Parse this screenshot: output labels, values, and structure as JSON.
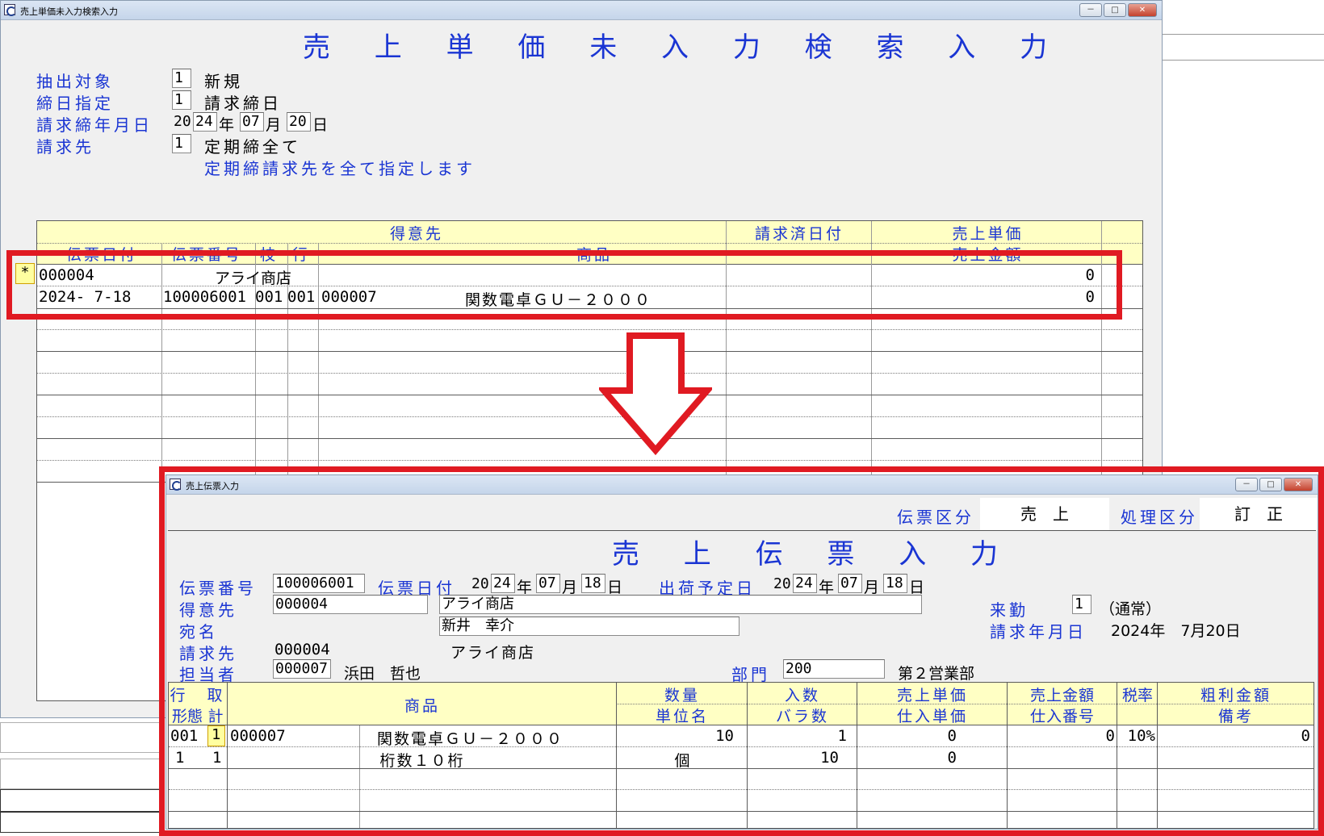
{
  "search_window": {
    "title": "売上単価未入力検索入力",
    "heading": "売 上 単 価 未 入 力 検 索 入 力",
    "titlebar_buttons": {
      "minimize": "－",
      "maximize": "□",
      "close": "✕"
    },
    "form": {
      "extract_label": "抽出対象",
      "extract_value": "1",
      "extract_text": "新規",
      "closing_label": "締日指定",
      "closing_value": "1",
      "closing_text": "請求締日",
      "date_label": "請求締年月日",
      "date_prefix": "20",
      "date_year": "24",
      "date_year_unit": "年",
      "date_month": "07",
      "date_month_unit": "月",
      "date_day": "20",
      "date_day_unit": "日",
      "billing_label": "請求先",
      "billing_value": "1",
      "billing_text": "定期締全て",
      "billing_note": "定期締請求先を全て指定します"
    },
    "grid": {
      "head_row1": {
        "customer": "得意先",
        "billed_date": "請求済日付",
        "unit_price": "売上単価"
      },
      "head_row2": {
        "slip_date": "伝票日付",
        "slip_no": "伝票番号",
        "branch": "枝",
        "line": "行",
        "product": "商品",
        "amount": "売上金額"
      },
      "marker": "*",
      "row1": {
        "customer_code": "000004",
        "customer_name": "アライ商店",
        "unit_price": "0"
      },
      "row2": {
        "slip_date": "2024- 7-18",
        "slip_no": "100006001",
        "branch": "001",
        "line": "001",
        "product_code": "000007",
        "product_name": "関数電卓ＧＵ－２０００",
        "amount": "0"
      }
    }
  },
  "slip_window": {
    "title": "売上伝票入力",
    "heading": "売 上 伝 票 入 力",
    "titlebar_buttons": {
      "minimize": "－",
      "maximize": "□",
      "close": "✕"
    },
    "top": {
      "slip_type_label": "伝票区分",
      "slip_type_value": "売　上",
      "process_label": "処理区分",
      "process_value": "訂　正"
    },
    "form": {
      "slip_no_label": "伝票番号",
      "slip_no": "100006001",
      "slip_date_label": "伝票日付",
      "slip_date_prefix": "20",
      "slip_date_year": "24",
      "slip_date_month": "07",
      "slip_date_day": "18",
      "ship_date_label": "出荷予定日",
      "ship_date_prefix": "20",
      "ship_date_year": "24",
      "ship_date_month": "07",
      "ship_date_day": "18",
      "unit_year": "年",
      "unit_month": "月",
      "unit_day": "日",
      "customer_label": "得意先",
      "customer_code": "000004",
      "customer_name": "アライ商店",
      "visit_label": "来勤",
      "visit_value": "1",
      "visit_text": "（通常）",
      "addressee_label": "宛名",
      "addressee": "新井　幸介",
      "bill_month_label": "請求年月日",
      "bill_month_value": "2024年　7月20日",
      "billing_label": "請求先",
      "billing_code": "000004",
      "billing_name": "アライ商店",
      "staff_label": "担当者",
      "staff_code": "000007",
      "staff_name": "浜田　哲也",
      "dept_label": "部門",
      "dept_code": "200",
      "dept_name": "第２営業部"
    },
    "grid": {
      "head": {
        "line": "行",
        "take": "取",
        "form": "形態",
        "total": "計",
        "product": "商品",
        "qty": "数量",
        "unit_name": "単位名",
        "in_count": "入数",
        "loose": "バラ数",
        "sale_price": "売上単価",
        "purchase_price": "仕入単価",
        "sale_amount": "売上金額",
        "purchase_no": "仕入番号",
        "tax": "税率",
        "gross": "粗利金額",
        "memo": "備考"
      },
      "row1": {
        "line": "001",
        "take": "1",
        "product_code": "000007",
        "product_name": "関数電卓ＧＵ－２０００",
        "qty": "10",
        "in_count": "1",
        "sale_price": "0",
        "sale_amount": "0",
        "tax": "10%",
        "gross": "0"
      },
      "row2": {
        "form": "1",
        "total": "1",
        "spec": "桁数１０桁",
        "unit_name": "個",
        "loose": "10",
        "purchase_price": "0"
      }
    }
  }
}
